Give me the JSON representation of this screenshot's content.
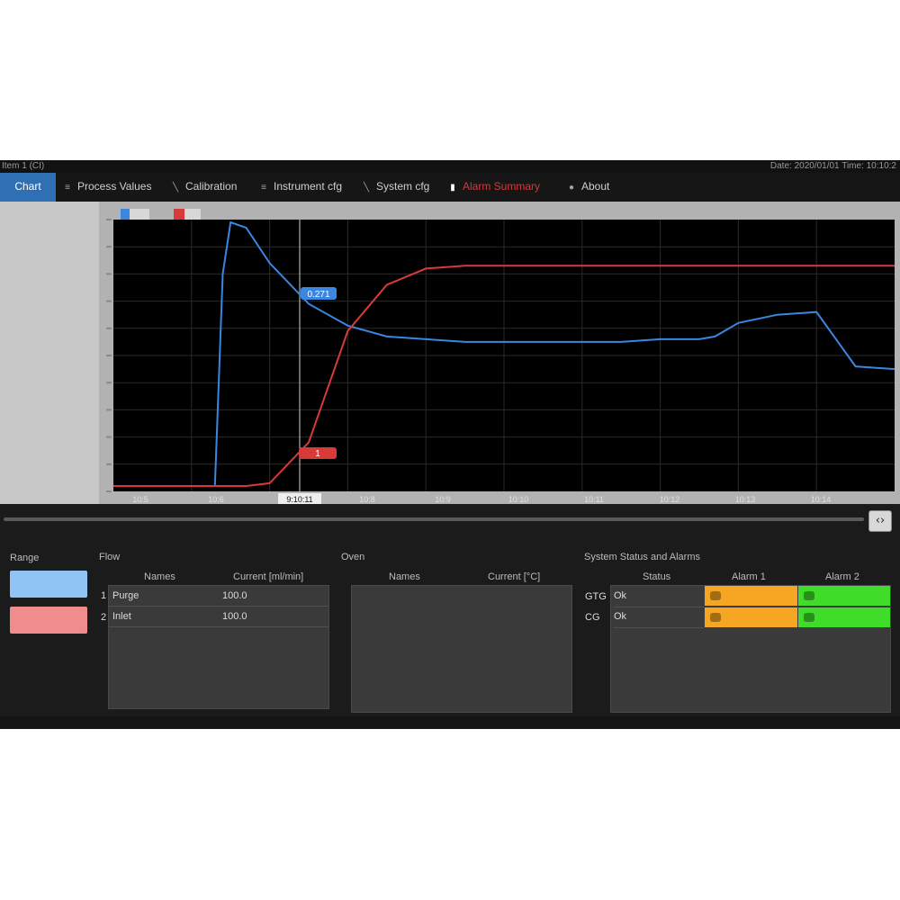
{
  "titlebar": {
    "left": "Item 1 (CI)",
    "right": "Date: 2020/01/01  Time: 10:10:2"
  },
  "toolbar": {
    "items": [
      {
        "label": "Chart",
        "icon": ""
      },
      {
        "label": "Process Values",
        "icon": "list-icon"
      },
      {
        "label": "Calibration",
        "icon": "wrench-icon"
      },
      {
        "label": "Instrument cfg",
        "icon": "list-icon"
      },
      {
        "label": "System cfg",
        "icon": "wrench-icon"
      },
      {
        "label": "Alarm Summary",
        "icon": "alarm-icon"
      },
      {
        "label": "About",
        "icon": "chat-bubble-icon"
      }
    ]
  },
  "chart": {
    "legend_colors": [
      "#3b86e0",
      "#d83a3a"
    ],
    "marker_blue": "0.271",
    "marker_red": "1",
    "cursor_label": "9:10:11",
    "x_ticks": [
      "10:5",
      "10:6",
      "9:10:11",
      "10:8",
      "10:9",
      "10:10",
      "10:11",
      "10:12",
      "10:13",
      "10:14"
    ]
  },
  "chart_data": {
    "type": "line",
    "title": "",
    "xlabel": "",
    "ylabel": "",
    "x": [
      0,
      5,
      10,
      13,
      14,
      15,
      17,
      20,
      25,
      30,
      35,
      40,
      45,
      50,
      55,
      60,
      65,
      70,
      75,
      77,
      80,
      85,
      90,
      95,
      100
    ],
    "ylim": [
      0,
      100
    ],
    "series": [
      {
        "color": "#3b86e0",
        "values": [
          2,
          2,
          2,
          2,
          80,
          99,
          97,
          84,
          69,
          61,
          57,
          56,
          55,
          55,
          55,
          55,
          55,
          56,
          56,
          57,
          62,
          65,
          66,
          46,
          45
        ]
      },
      {
        "color": "#d83a3a",
        "values": [
          2,
          2,
          2,
          2,
          2,
          2,
          2,
          3,
          18,
          59,
          76,
          82,
          83,
          83,
          83,
          83,
          83,
          83,
          83,
          83,
          83,
          83,
          83,
          83,
          83
        ]
      }
    ]
  },
  "range": {
    "title": "Range",
    "colors": [
      "#8fc4f5",
      "#f08c8c"
    ]
  },
  "flow": {
    "title": "Flow",
    "col_names": "Names",
    "col_current": "Current [ml/min]",
    "rows": [
      {
        "idx": "1",
        "name": "Purge",
        "value": "100.0"
      },
      {
        "idx": "2",
        "name": "Inlet",
        "value": "100.0"
      }
    ]
  },
  "oven": {
    "title": "Oven",
    "col_names": "Names",
    "col_current": "Current [°C]"
  },
  "status": {
    "title": "System Status and Alarms",
    "col_status": "Status",
    "col_alarm1": "Alarm 1",
    "col_alarm2": "Alarm 2",
    "rows": [
      {
        "label": "GTG",
        "status": "Ok",
        "alarm1_color": "#f6a623",
        "alarm2_color": "#3fdc2a"
      },
      {
        "label": "CG",
        "status": "Ok",
        "alarm1_color": "#f6a623",
        "alarm2_color": "#3fdc2a"
      }
    ]
  }
}
